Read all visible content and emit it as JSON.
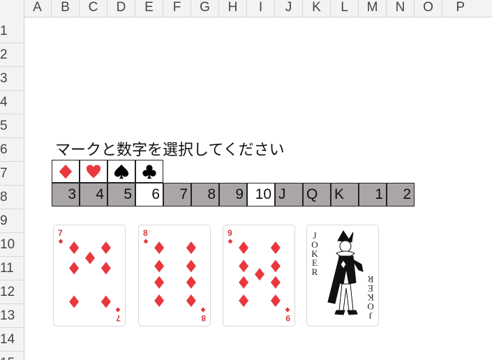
{
  "columns": [
    "A",
    "B",
    "C",
    "D",
    "E",
    "F",
    "G",
    "H",
    "I",
    "J",
    "K",
    "L",
    "M",
    "N",
    "O",
    "P"
  ],
  "rows": [
    "1",
    "2",
    "3",
    "4",
    "5",
    "6",
    "7",
    "8",
    "9",
    "10",
    "11",
    "12",
    "13",
    "14",
    "15"
  ],
  "instruction": "マークと数字を選択してください",
  "suits": [
    {
      "name": "diamond",
      "icon": "diamond-icon",
      "color": "#e8383d"
    },
    {
      "name": "heart",
      "icon": "heart-icon",
      "color": "#e8383d"
    },
    {
      "name": "spade",
      "icon": "spade-icon",
      "color": "#000000"
    },
    {
      "name": "club",
      "icon": "club-icon",
      "color": "#000000"
    }
  ],
  "numbers": [
    {
      "label": "3",
      "align": "right",
      "selected": false
    },
    {
      "label": "4",
      "align": "right",
      "selected": false
    },
    {
      "label": "5",
      "align": "right",
      "selected": false
    },
    {
      "label": "6",
      "align": "right",
      "selected": true
    },
    {
      "label": "7",
      "align": "right",
      "selected": false
    },
    {
      "label": "8",
      "align": "right",
      "selected": false
    },
    {
      "label": "9",
      "align": "right",
      "selected": false
    },
    {
      "label": "10",
      "align": "right",
      "selected": true
    },
    {
      "label": "J",
      "align": "left",
      "selected": false
    },
    {
      "label": "Q",
      "align": "left",
      "selected": false
    },
    {
      "label": "K",
      "align": "left",
      "selected": false
    },
    {
      "label": "1",
      "align": "right",
      "selected": false
    },
    {
      "label": "2",
      "align": "right",
      "selected": false
    }
  ],
  "cards": [
    {
      "rank": "7",
      "suit": "diamond"
    },
    {
      "rank": "8",
      "suit": "diamond"
    },
    {
      "rank": "9",
      "suit": "diamond"
    },
    {
      "rank": "JOKER",
      "suit": "joker"
    }
  ],
  "colors": {
    "red_suit": "#e8383d",
    "black_suit": "#000000",
    "cell_gray": "#aaa6a6",
    "header_bg": "#f3f3f3"
  }
}
